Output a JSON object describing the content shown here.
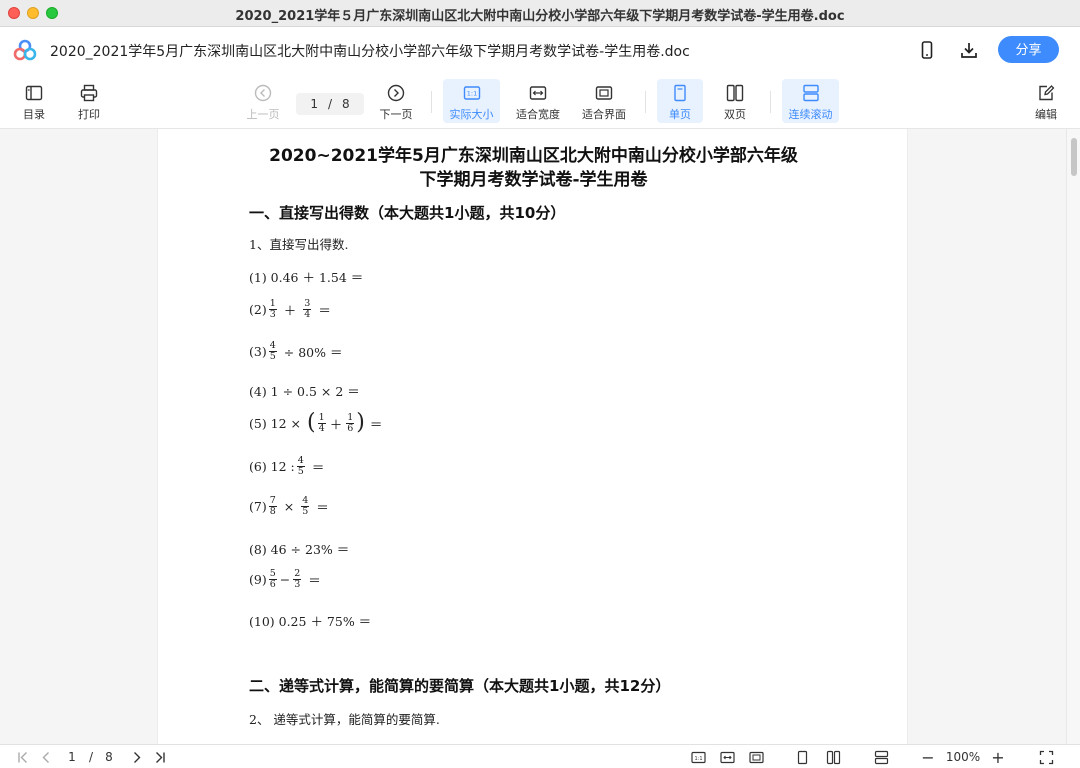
{
  "window": {
    "title": "2020_2021学年５月广东深圳南山区北大附中南山分校小学部六年级下学期月考数学试卷-学生用卷.doc"
  },
  "header": {
    "doc_title": "2020_2021学年5月广东深圳南山区北大附中南山分校小学部六年级下学期月考数学试卷-学生用卷.doc",
    "share_label": "分享",
    "icons": [
      "phone-icon",
      "download-icon"
    ]
  },
  "toolbar": {
    "toc_label": "目录",
    "print_label": "打印",
    "prev_label": "上一页",
    "current_page": "1",
    "page_sep": "/",
    "total_pages": "8",
    "next_label": "下一页",
    "actual_size_label": "实际大小",
    "fit_width_label": "适合宽度",
    "fit_page_label": "适合界面",
    "single_page_label": "单页",
    "double_page_label": "双页",
    "continuous_label": "连续滚动",
    "edit_label": "编辑",
    "accent_color": "#3d8bfd"
  },
  "document": {
    "heading_line1": "2020~2021学年5月广东深圳南山区北大附中南山分校小学部六年级",
    "heading_line2": "下学期月考数学试卷-学生用卷",
    "section1_title": "一、直接写出得数（本大题共1小题，共10分）",
    "section1_intro": "1、直接写出得数.",
    "p1": "(1) 0.46 ＋ 1.54 ＝",
    "p2_label": "(2)",
    "p2_f1_num": "1",
    "p2_f1_den": "3",
    "p2_op": "＋",
    "p2_f2_num": "3",
    "p2_f2_den": "4",
    "p2_eq": "＝",
    "p3_label": "(3)",
    "p3_f1_num": "4",
    "p3_f1_den": "5",
    "p3_rest": "÷ 80% ＝",
    "p4": "(4) 1 ÷ 0.5 × 2 ＝",
    "p5_label": "(5) 12 ×",
    "p5_lparen": "(",
    "p5_f1_num": "1",
    "p5_f1_den": "4",
    "p5_op": "＋",
    "p5_f2_num": "1",
    "p5_f2_den": "6",
    "p5_rparen": ")",
    "p5_eq": "＝",
    "p6_label": "(6) 12 :",
    "p6_f1_num": "4",
    "p6_f1_den": "5",
    "p6_eq": "＝",
    "p7_label": "(7)",
    "p7_f1_num": "7",
    "p7_f1_den": "8",
    "p7_op": "×",
    "p7_f2_num": "4",
    "p7_f2_den": "5",
    "p7_eq": "＝",
    "p8": "(8) 46 ÷ 23% ＝",
    "p9_label": "(9)",
    "p9_f1_num": "5",
    "p9_f1_den": "6",
    "p9_op": "−",
    "p9_f2_num": "2",
    "p9_f2_den": "3",
    "p9_eq": "＝",
    "p10": "(10) 0.25 ＋ 75% ＝",
    "section2_title": "二、递等式计算，能简算的要简算（本大题共1小题，共12分）",
    "section2_intro": "2、 递等式计算，能简算的要简算."
  },
  "statusbar": {
    "current_page": "1",
    "page_sep": "/",
    "total_pages": "8",
    "zoom": "100%",
    "zoom_minus": "−",
    "zoom_plus": "+"
  }
}
